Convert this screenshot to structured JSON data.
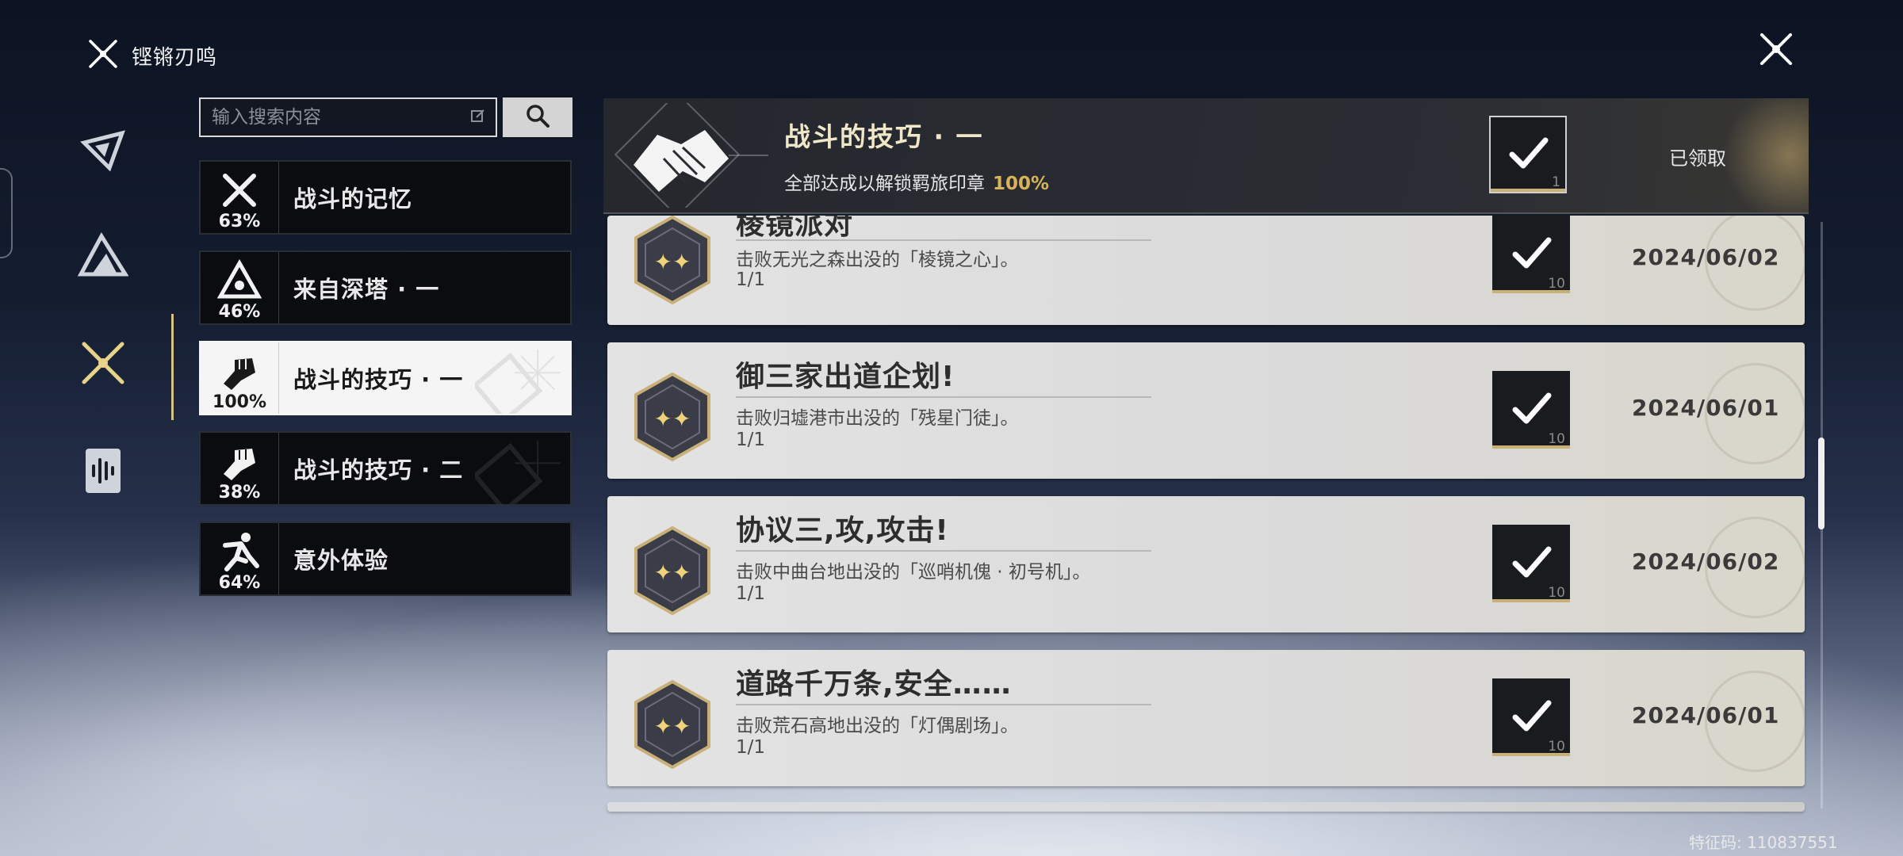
{
  "app": {
    "title": "铿锵刃鸣"
  },
  "search": {
    "placeholder": "输入搜索内容"
  },
  "categories": [
    {
      "label": "战斗的记忆",
      "percent": "63%",
      "icon": "crossed-swords-icon",
      "active": false
    },
    {
      "label": "来自深塔 · 一",
      "percent": "46%",
      "icon": "tower-triangle-icon",
      "active": false
    },
    {
      "label": "战斗的技巧 · 一",
      "percent": "100%",
      "icon": "fist-icon",
      "active": true
    },
    {
      "label": "战斗的技巧 · 二",
      "percent": "38%",
      "icon": "fist-icon",
      "active": false
    },
    {
      "label": "意外体验",
      "percent": "64%",
      "icon": "running-figure-icon",
      "active": false
    }
  ],
  "summary": {
    "title": "战斗的技巧 · 一",
    "description": "全部达成以解锁羁旅印章",
    "percent": "100%",
    "reward_count": "1",
    "status": "已领取",
    "icon": "handshake-emblem-icon"
  },
  "achievements": [
    {
      "title": "棱镜派对",
      "description": "击败无光之森出没的「棱镜之心」。",
      "progress": "1/1",
      "reward_count": "10",
      "date": "2024/06/02"
    },
    {
      "title": "御三家出道企划!",
      "description": "击败归墟港市出没的「残星门徒」。",
      "progress": "1/1",
      "reward_count": "10",
      "date": "2024/06/01"
    },
    {
      "title": "协议三,攻,攻击!",
      "description": "击败中曲台地出没的「巡哨机傀 · 初号机」。",
      "progress": "1/1",
      "reward_count": "10",
      "date": "2024/06/02"
    },
    {
      "title": "道路千万条,安全……",
      "description": "击败荒石高地出没的「灯偶剧场」。",
      "progress": "1/1",
      "reward_count": "10",
      "date": "2024/06/01"
    }
  ],
  "footer": {
    "feature_code": "特征码: 110837551"
  },
  "colors": {
    "accent_gold": "#d9b35a",
    "active_bar": "#d8c184",
    "row_bg": "#e3e3e3"
  }
}
